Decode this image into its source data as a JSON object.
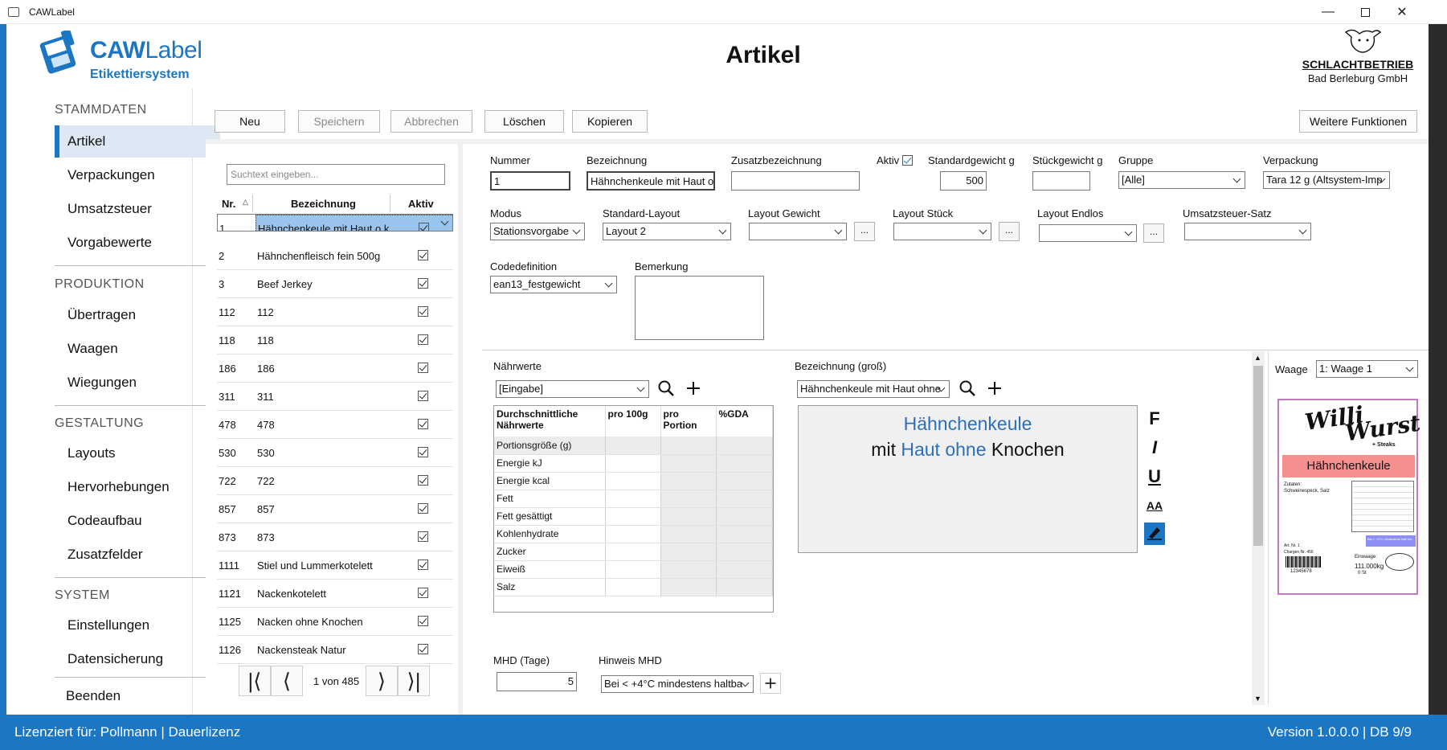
{
  "window": {
    "title": "CAWLabel"
  },
  "header": {
    "logo_main": "CAW",
    "logo_main2": "Label",
    "logo_sub": "Etikettiersystem",
    "page_title": "Artikel",
    "brand_name": "SCHLACHTBETRIEB",
    "brand_sub": "Bad Berleburg GmbH"
  },
  "sidebar": {
    "sections": [
      "STAMMDATEN",
      "PRODUKTION",
      "GESTALTUNG",
      "SYSTEM"
    ],
    "stammdaten": [
      "Artikel",
      "Verpackungen",
      "Umsatzsteuer",
      "Vorgabewerte"
    ],
    "produktion": [
      "Übertragen",
      "Waagen",
      "Wiegungen"
    ],
    "gestaltung": [
      "Layouts",
      "Hervorhebungen",
      "Codeaufbau",
      "Zusatzfelder"
    ],
    "system": [
      "Einstellungen",
      "Datensicherung"
    ],
    "beenden": "Beenden"
  },
  "toolbar": {
    "neu": "Neu",
    "speichern": "Speichern",
    "abbrechen": "Abbrechen",
    "loeschen": "Löschen",
    "kopieren": "Kopieren",
    "weitere": "Weitere Funktionen"
  },
  "list": {
    "search_placeholder": "Suchtext eingeben...",
    "col_nr": "Nr.",
    "col_bez": "Bezeichnung",
    "col_aktiv": "Aktiv",
    "rows": [
      {
        "nr": "1",
        "bez": "Hähnchenkeule mit Haut o.k."
      },
      {
        "nr": "2",
        "bez": "Hähnchenfleisch fein 500g"
      },
      {
        "nr": "3",
        "bez": "Beef Jerkey"
      },
      {
        "nr": "112",
        "bez": "112"
      },
      {
        "nr": "118",
        "bez": "118"
      },
      {
        "nr": "186",
        "bez": "186"
      },
      {
        "nr": "311",
        "bez": "311"
      },
      {
        "nr": "478",
        "bez": "478"
      },
      {
        "nr": "530",
        "bez": "530"
      },
      {
        "nr": "722",
        "bez": "722"
      },
      {
        "nr": "857",
        "bez": "857"
      },
      {
        "nr": "873",
        "bez": "873"
      },
      {
        "nr": "1111",
        "bez": "Stiel und Lummerkotelett"
      },
      {
        "nr": "1121",
        "bez": "Nackenkotelett"
      },
      {
        "nr": "1125",
        "bez": "Nacken ohne Knochen"
      },
      {
        "nr": "1126",
        "bez": "Nackensteak Natur"
      }
    ],
    "pager": "1 von 485"
  },
  "form": {
    "nummer_label": "Nummer",
    "nummer": "1",
    "bezeichnung_label": "Bezeichnung",
    "bezeichnung": "Hähnchenkeule mit Haut o.",
    "zusatz_label": "Zusatzbezeichnung",
    "zusatz": "",
    "aktiv_label": "Aktiv",
    "stdgewicht_label": "Standardgewicht g",
    "stdgewicht": "500",
    "stkgewicht_label": "Stückgewicht g",
    "stkgewicht": "",
    "gruppe_label": "Gruppe",
    "gruppe": "[Alle]",
    "verpackung_label": "Verpackung",
    "verpackung": "Tara 12 g (Altsystem-Imp",
    "modus_label": "Modus",
    "modus": "Stationsvorgabe",
    "stdlayout_label": "Standard-Layout",
    "stdlayout": "Layout 2",
    "lgewicht_label": "Layout Gewicht",
    "lstueck_label": "Layout Stück",
    "lendlos_label": "Layout Endlos",
    "ust_label": "Umsatzsteuer-Satz",
    "codedef_label": "Codedefinition",
    "codedef": "ean13_festgewicht",
    "bemerkung_label": "Bemerkung",
    "dots": "..."
  },
  "naehrwerte": {
    "label": "Nährwerte",
    "mode": "[Eingabe]",
    "h1a": "Durchschnittliche",
    "h1b": "Nährwerte",
    "h2": "pro 100g",
    "h3a": "pro",
    "h3b": "Portion",
    "h4": "%GDA",
    "rows": [
      "Portionsgröße (g)",
      "Energie kJ",
      "Energie kcal",
      "Fett",
      "Fett gesättigt",
      "Kohlenhydrate",
      "Zucker",
      "Eiweiß",
      "Salz"
    ]
  },
  "bezgross": {
    "label": "Bezeichnung (groß)",
    "select": "Hähnchenkeule mit Haut ohne",
    "line1": "Hähnchenkeule",
    "line2a": "mit",
    "line2b": "Haut ohne",
    "line2c": "Knochen"
  },
  "fmt": {
    "bold": "F",
    "italic": "I",
    "underline": "U",
    "size": "AA"
  },
  "mhd": {
    "label": "MHD (Tage)",
    "value": "5",
    "hinweis_label": "Hinweis MHD",
    "hinweis": "Bei < +4°C mindestens haltba"
  },
  "waage": {
    "label": "Waage",
    "value": "1: Waage 1"
  },
  "preview": {
    "logo1": "Willi",
    "logo2": "Wurst",
    "logo3": "+ Steaks",
    "product": "Hähnchenkeule",
    "zutaten_label": "Zutaten:",
    "zutaten": "Schweinespeck, Salz",
    "artnr": "Art. Nr.  1",
    "charge": "Chargen Nr.  456",
    "barcode_num": "12345678",
    "einwaage_label": "Einwaage:",
    "einwaage": "111.000kg",
    "stueck": "0 St",
    "note": "Bei < +4°C mindestens halt bis:"
  },
  "status": {
    "left": "Lizenziert für: Pollmann | Dauerlizenz",
    "right": "Version 1.0.0.0  |  DB 9/9"
  },
  "colors": {
    "accent": "#1b76c3",
    "selection": "#9bc4ec",
    "preview_banner": "#f5908f"
  }
}
